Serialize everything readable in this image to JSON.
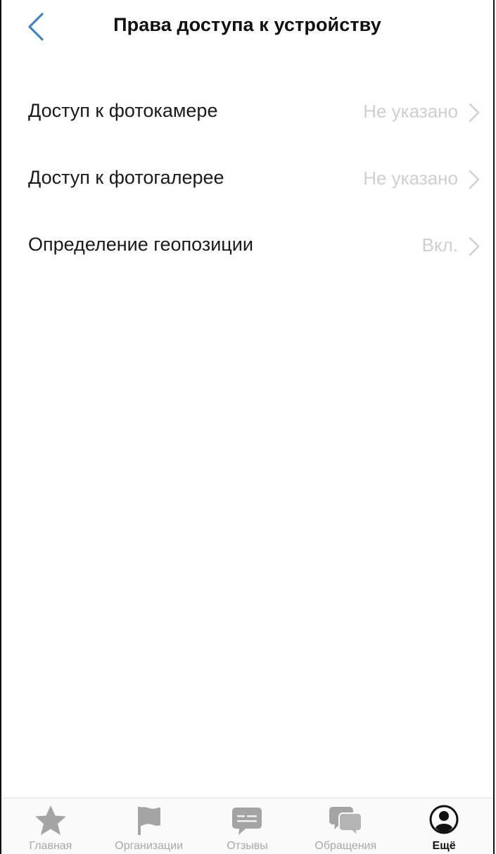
{
  "header": {
    "title": "Права доступа к устройству",
    "back_icon": "chevron-left-icon",
    "accent_color": "#3d86c6"
  },
  "settings": [
    {
      "label": "Доступ к фотокамере",
      "value": "Не указано"
    },
    {
      "label": "Доступ к фотогалерее",
      "value": "Не указано"
    },
    {
      "label": "Определение геопозиции",
      "value": "Вкл."
    }
  ],
  "tabbar": {
    "items": [
      {
        "label": "Главная",
        "icon": "star-icon",
        "active": false
      },
      {
        "label": "Организации",
        "icon": "flag-icon",
        "active": false
      },
      {
        "label": "Отзывы",
        "icon": "comment-icon",
        "active": false
      },
      {
        "label": "Обращения",
        "icon": "chat-bubbles-icon",
        "active": false
      },
      {
        "label": "Ещё",
        "icon": "profile-icon",
        "active": true
      }
    ]
  }
}
